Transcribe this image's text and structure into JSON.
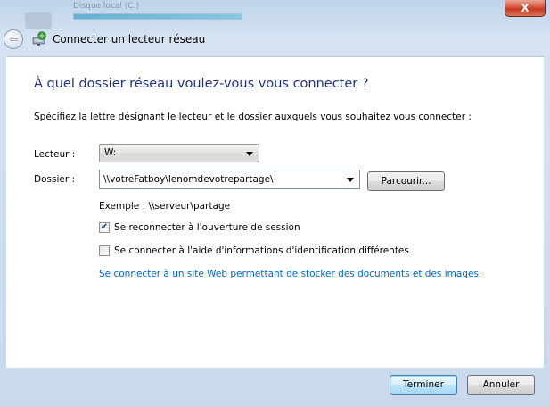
{
  "background": {
    "blurred_title": "Disque local (C:)"
  },
  "window": {
    "title": "Connecter un lecteur réseau",
    "close_glyph": "X"
  },
  "nav": {
    "back_glyph": "⇦"
  },
  "main": {
    "heading": "À quel dossier réseau voulez-vous vous connecter ?",
    "instructions": "Spécifiez la lettre désignant le lecteur et le dossier auxquels vous souhaitez vous connecter :",
    "drive_label": "Lecteur :",
    "drive_value": "W:",
    "folder_label": "Dossier :",
    "folder_value": "\\\\votreFatboy\\lenomdevotrepartage\\",
    "browse_label": "Parcourir...",
    "example": "Exemple : \\\\serveur\\partage",
    "reconnect_label": "Se reconnecter à l'ouverture de session",
    "reconnect_checked": true,
    "credentials_label": "Se connecter à l'aide d'informations d'identification différentes",
    "credentials_checked": false,
    "web_link": "Se connecter à un site Web permettant de stocker des documents et des images",
    "web_link_suffix": "."
  },
  "footer": {
    "finish_label": "Terminer",
    "cancel_label": "Annuler"
  },
  "colors": {
    "heading": "#1e3287",
    "link": "#0066cc",
    "close_button": "#c23a1f"
  }
}
